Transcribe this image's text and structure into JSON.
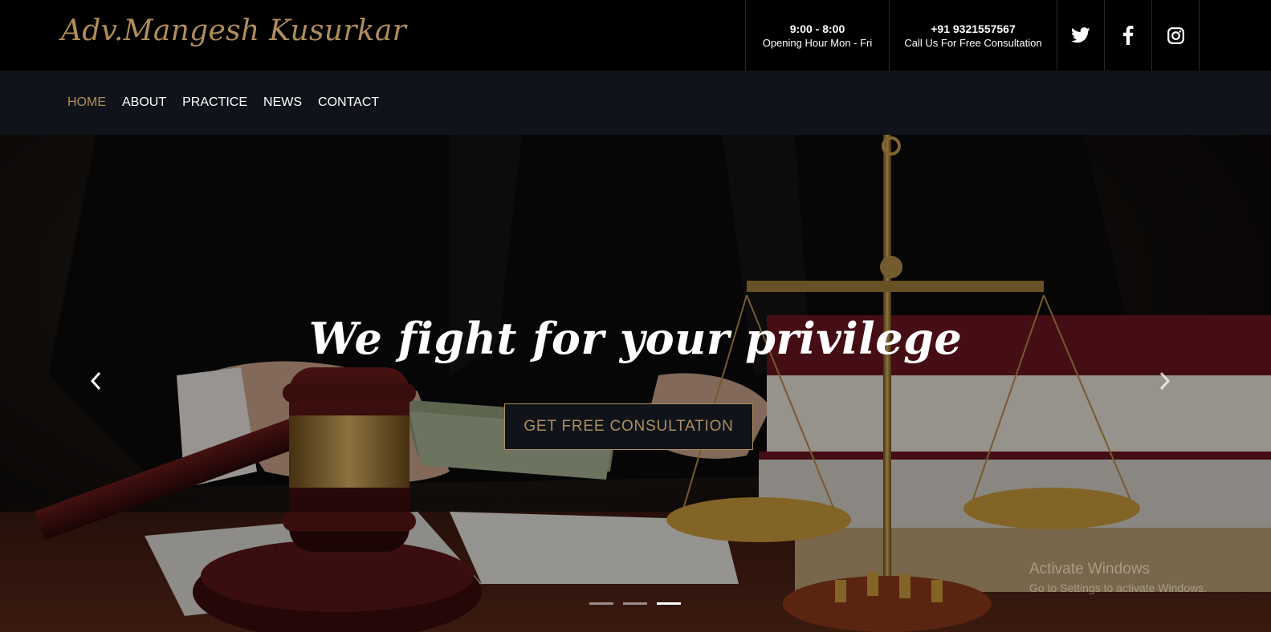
{
  "header": {
    "logo_text": "Adv.Mangesh Kusurkar",
    "hours": {
      "title": "9:00 - 8:00",
      "subtitle": "Opening Hour Mon - Fri"
    },
    "phone": {
      "title": "+91 9321557567",
      "subtitle": "Call Us For Free Consultation"
    },
    "social": [
      {
        "name": "twitter",
        "icon": "twitter-icon"
      },
      {
        "name": "facebook",
        "icon": "facebook-icon"
      },
      {
        "name": "instagram",
        "icon": "instagram-icon"
      }
    ]
  },
  "nav": {
    "items": [
      {
        "label": "HOME",
        "active": true
      },
      {
        "label": "ABOUT"
      },
      {
        "label": "PRACTICE"
      },
      {
        "label": "NEWS"
      },
      {
        "label": "CONTACT"
      }
    ]
  },
  "hero": {
    "headline": "We fight for your privilege",
    "cta_label": "GET FREE CONSULTATION",
    "slides_total": 3,
    "active_slide": 3
  },
  "watermark": {
    "title": "Activate Windows",
    "subtitle": "Go to Settings to activate Windows."
  },
  "colors": {
    "accent_gold": "#b08d5b",
    "topbar_bg": "#000000",
    "navbar_bg": "#10141a"
  }
}
